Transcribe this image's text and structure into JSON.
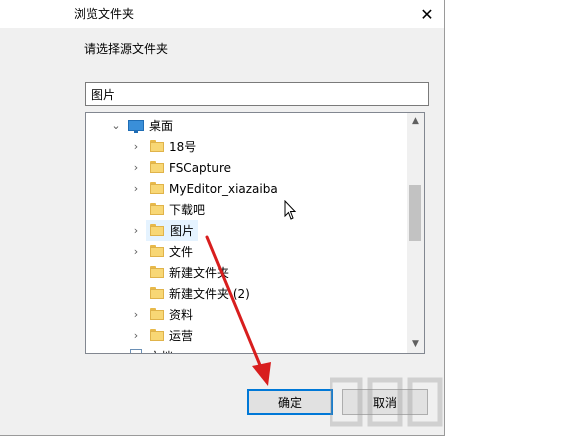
{
  "window": {
    "title": "浏览文件夹",
    "close_glyph": "✕"
  },
  "prompt": "请选择源文件夹",
  "path_field": {
    "value": "图片"
  },
  "tree": {
    "root": {
      "label": "桌面",
      "icon": "desktop-icon",
      "expanded": true
    },
    "items": [
      {
        "label": "18号",
        "has_children": true
      },
      {
        "label": "FSCapture",
        "has_children": true
      },
      {
        "label": "MyEditor_xiazaiba",
        "has_children": true
      },
      {
        "label": "下载吧",
        "has_children": false
      },
      {
        "label": "图片",
        "has_children": true,
        "selected": true
      },
      {
        "label": "文件",
        "has_children": true
      },
      {
        "label": "新建文件夹",
        "has_children": false
      },
      {
        "label": "新建文件夹 (2)",
        "has_children": false
      },
      {
        "label": "资料",
        "has_children": true
      },
      {
        "label": "运营",
        "has_children": true
      },
      {
        "label": "文档",
        "has_children": true,
        "icon": "document-icon"
      }
    ]
  },
  "buttons": {
    "ok": "确定",
    "cancel": "取消"
  },
  "colors": {
    "annotation_arrow": "#d81e1e",
    "selection": "#e5f3ff",
    "default_button_border": "#0078d7",
    "folder": "#f8d775"
  }
}
